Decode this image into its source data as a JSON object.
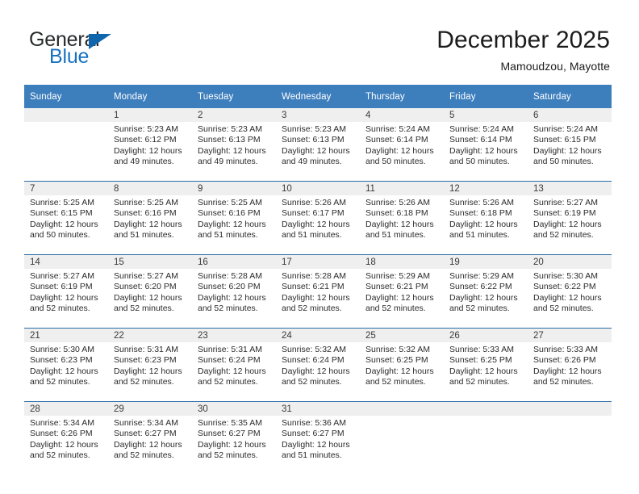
{
  "brand": {
    "word_one": "General",
    "word_two": "Blue",
    "triangle_color": "#1066ad",
    "blue_color": "#1771c0"
  },
  "header": {
    "title": "December 2025",
    "subtitle": "Mamoudzou, Mayotte"
  },
  "theme": {
    "header_row_bg": "#3d7ebd",
    "row_divider": "#2b6ca8",
    "day_band_bg": "#efefef",
    "text": "#2b2b2b"
  },
  "weekday_headers": [
    "Sunday",
    "Monday",
    "Tuesday",
    "Wednesday",
    "Thursday",
    "Friday",
    "Saturday"
  ],
  "weeks": [
    [
      {
        "day": "",
        "sunrise": "",
        "sunset": "",
        "daylight": "",
        "empty": true
      },
      {
        "day": "1",
        "sunrise": "Sunrise: 5:23 AM",
        "sunset": "Sunset: 6:12 PM",
        "daylight": "Daylight: 12 hours and 49 minutes."
      },
      {
        "day": "2",
        "sunrise": "Sunrise: 5:23 AM",
        "sunset": "Sunset: 6:13 PM",
        "daylight": "Daylight: 12 hours and 49 minutes."
      },
      {
        "day": "3",
        "sunrise": "Sunrise: 5:23 AM",
        "sunset": "Sunset: 6:13 PM",
        "daylight": "Daylight: 12 hours and 49 minutes."
      },
      {
        "day": "4",
        "sunrise": "Sunrise: 5:24 AM",
        "sunset": "Sunset: 6:14 PM",
        "daylight": "Daylight: 12 hours and 50 minutes."
      },
      {
        "day": "5",
        "sunrise": "Sunrise: 5:24 AM",
        "sunset": "Sunset: 6:14 PM",
        "daylight": "Daylight: 12 hours and 50 minutes."
      },
      {
        "day": "6",
        "sunrise": "Sunrise: 5:24 AM",
        "sunset": "Sunset: 6:15 PM",
        "daylight": "Daylight: 12 hours and 50 minutes."
      }
    ],
    [
      {
        "day": "7",
        "sunrise": "Sunrise: 5:25 AM",
        "sunset": "Sunset: 6:15 PM",
        "daylight": "Daylight: 12 hours and 50 minutes."
      },
      {
        "day": "8",
        "sunrise": "Sunrise: 5:25 AM",
        "sunset": "Sunset: 6:16 PM",
        "daylight": "Daylight: 12 hours and 51 minutes."
      },
      {
        "day": "9",
        "sunrise": "Sunrise: 5:25 AM",
        "sunset": "Sunset: 6:16 PM",
        "daylight": "Daylight: 12 hours and 51 minutes."
      },
      {
        "day": "10",
        "sunrise": "Sunrise: 5:26 AM",
        "sunset": "Sunset: 6:17 PM",
        "daylight": "Daylight: 12 hours and 51 minutes."
      },
      {
        "day": "11",
        "sunrise": "Sunrise: 5:26 AM",
        "sunset": "Sunset: 6:18 PM",
        "daylight": "Daylight: 12 hours and 51 minutes."
      },
      {
        "day": "12",
        "sunrise": "Sunrise: 5:26 AM",
        "sunset": "Sunset: 6:18 PM",
        "daylight": "Daylight: 12 hours and 51 minutes."
      },
      {
        "day": "13",
        "sunrise": "Sunrise: 5:27 AM",
        "sunset": "Sunset: 6:19 PM",
        "daylight": "Daylight: 12 hours and 52 minutes."
      }
    ],
    [
      {
        "day": "14",
        "sunrise": "Sunrise: 5:27 AM",
        "sunset": "Sunset: 6:19 PM",
        "daylight": "Daylight: 12 hours and 52 minutes."
      },
      {
        "day": "15",
        "sunrise": "Sunrise: 5:27 AM",
        "sunset": "Sunset: 6:20 PM",
        "daylight": "Daylight: 12 hours and 52 minutes."
      },
      {
        "day": "16",
        "sunrise": "Sunrise: 5:28 AM",
        "sunset": "Sunset: 6:20 PM",
        "daylight": "Daylight: 12 hours and 52 minutes."
      },
      {
        "day": "17",
        "sunrise": "Sunrise: 5:28 AM",
        "sunset": "Sunset: 6:21 PM",
        "daylight": "Daylight: 12 hours and 52 minutes."
      },
      {
        "day": "18",
        "sunrise": "Sunrise: 5:29 AM",
        "sunset": "Sunset: 6:21 PM",
        "daylight": "Daylight: 12 hours and 52 minutes."
      },
      {
        "day": "19",
        "sunrise": "Sunrise: 5:29 AM",
        "sunset": "Sunset: 6:22 PM",
        "daylight": "Daylight: 12 hours and 52 minutes."
      },
      {
        "day": "20",
        "sunrise": "Sunrise: 5:30 AM",
        "sunset": "Sunset: 6:22 PM",
        "daylight": "Daylight: 12 hours and 52 minutes."
      }
    ],
    [
      {
        "day": "21",
        "sunrise": "Sunrise: 5:30 AM",
        "sunset": "Sunset: 6:23 PM",
        "daylight": "Daylight: 12 hours and 52 minutes."
      },
      {
        "day": "22",
        "sunrise": "Sunrise: 5:31 AM",
        "sunset": "Sunset: 6:23 PM",
        "daylight": "Daylight: 12 hours and 52 minutes."
      },
      {
        "day": "23",
        "sunrise": "Sunrise: 5:31 AM",
        "sunset": "Sunset: 6:24 PM",
        "daylight": "Daylight: 12 hours and 52 minutes."
      },
      {
        "day": "24",
        "sunrise": "Sunrise: 5:32 AM",
        "sunset": "Sunset: 6:24 PM",
        "daylight": "Daylight: 12 hours and 52 minutes."
      },
      {
        "day": "25",
        "sunrise": "Sunrise: 5:32 AM",
        "sunset": "Sunset: 6:25 PM",
        "daylight": "Daylight: 12 hours and 52 minutes."
      },
      {
        "day": "26",
        "sunrise": "Sunrise: 5:33 AM",
        "sunset": "Sunset: 6:25 PM",
        "daylight": "Daylight: 12 hours and 52 minutes."
      },
      {
        "day": "27",
        "sunrise": "Sunrise: 5:33 AM",
        "sunset": "Sunset: 6:26 PM",
        "daylight": "Daylight: 12 hours and 52 minutes."
      }
    ],
    [
      {
        "day": "28",
        "sunrise": "Sunrise: 5:34 AM",
        "sunset": "Sunset: 6:26 PM",
        "daylight": "Daylight: 12 hours and 52 minutes."
      },
      {
        "day": "29",
        "sunrise": "Sunrise: 5:34 AM",
        "sunset": "Sunset: 6:27 PM",
        "daylight": "Daylight: 12 hours and 52 minutes."
      },
      {
        "day": "30",
        "sunrise": "Sunrise: 5:35 AM",
        "sunset": "Sunset: 6:27 PM",
        "daylight": "Daylight: 12 hours and 52 minutes."
      },
      {
        "day": "31",
        "sunrise": "Sunrise: 5:36 AM",
        "sunset": "Sunset: 6:27 PM",
        "daylight": "Daylight: 12 hours and 51 minutes."
      },
      {
        "day": "",
        "sunrise": "",
        "sunset": "",
        "daylight": "",
        "empty": true
      },
      {
        "day": "",
        "sunrise": "",
        "sunset": "",
        "daylight": "",
        "empty": true
      },
      {
        "day": "",
        "sunrise": "",
        "sunset": "",
        "daylight": "",
        "empty": true
      }
    ]
  ]
}
